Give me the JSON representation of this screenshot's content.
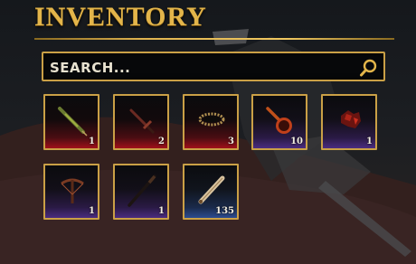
{
  "header": {
    "title": "INVENTORY"
  },
  "search": {
    "placeholder": "SEARCH...",
    "icon": "magnifier-icon"
  },
  "colors": {
    "gold": "#caa046",
    "red_rarity": "#a0101a",
    "purple_rarity": "#4a2c80",
    "blue_rarity": "#2c4c90"
  },
  "items": [
    {
      "icon": "syringe-icon",
      "count": "1",
      "rarity": "red"
    },
    {
      "icon": "dagger-icon",
      "count": "2",
      "rarity": "red"
    },
    {
      "icon": "crown-ring-icon",
      "count": "3",
      "rarity": "red"
    },
    {
      "icon": "frying-pan-icon",
      "count": "10",
      "rarity": "purple"
    },
    {
      "icon": "red-ore-icon",
      "count": "1",
      "rarity": "purple"
    },
    {
      "icon": "crossbow-icon",
      "count": "1",
      "rarity": "purple"
    },
    {
      "icon": "staff-icon",
      "count": "1",
      "rarity": "purple"
    },
    {
      "icon": "scroll-icon",
      "count": "135",
      "rarity": "blue"
    }
  ]
}
